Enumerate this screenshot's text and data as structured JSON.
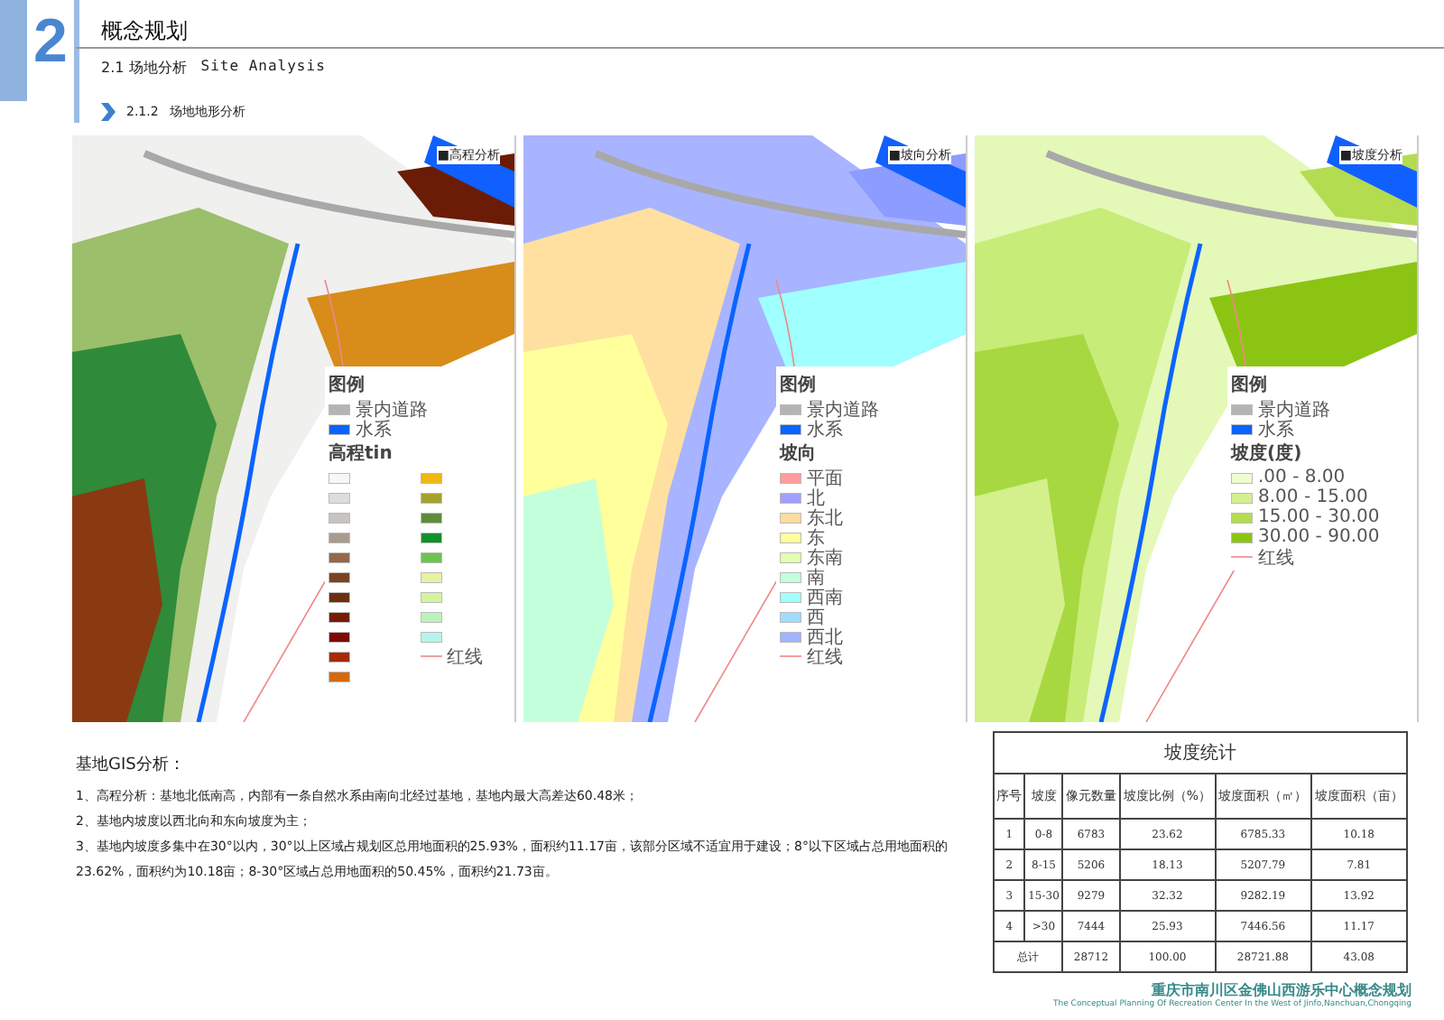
{
  "header": {
    "chapter_number": "2",
    "title": "概念规划",
    "section": "2.1 场地分析",
    "section_en": "Site Analysis",
    "subsection_number": "2.1.2",
    "subsection": "场地地形分析"
  },
  "maps": [
    {
      "kind": "elevation",
      "title": "■高程分析",
      "legend_title": "图例",
      "base_items": [
        {
          "label": "景内道路",
          "color": "#b4b4b4"
        },
        {
          "label": "水系",
          "color": "#0a64ff"
        }
      ],
      "class_title": "高程tin",
      "classes": [
        {
          "color": "#f7f7f7"
        },
        {
          "color": "#dddddd"
        },
        {
          "color": "#c6c3c0"
        },
        {
          "color": "#a99a8e"
        },
        {
          "color": "#94684c"
        },
        {
          "color": "#7a4424"
        },
        {
          "color": "#6e2e10"
        },
        {
          "color": "#761c04"
        },
        {
          "color": "#7c0a02"
        },
        {
          "color": "#a82a04"
        },
        {
          "color": "#d46a0c"
        },
        {
          "color": "#f0b812"
        },
        {
          "color": "#a4a22a"
        },
        {
          "color": "#5e8c3a"
        },
        {
          "color": "#12902e"
        },
        {
          "color": "#6cc44c"
        },
        {
          "color": "#e4f4a0"
        },
        {
          "color": "#d6f4a0"
        },
        {
          "color": "#b8f4bc"
        },
        {
          "color": "#b4f4ec"
        }
      ],
      "red_line": "红线"
    },
    {
      "kind": "aspect",
      "title": "■坡向分析",
      "legend_title": "图例",
      "base_items": [
        {
          "label": "景内道路",
          "color": "#b4b4b4"
        },
        {
          "label": "水系",
          "color": "#0a64ff"
        }
      ],
      "class_title": "坡向",
      "classes": [
        {
          "label": "平面",
          "color": "#ff9c9c"
        },
        {
          "label": "北",
          "color": "#a0a0ff"
        },
        {
          "label": "东北",
          "color": "#ffdca0"
        },
        {
          "label": "东",
          "color": "#ffff9c"
        },
        {
          "label": "东南",
          "color": "#e4ffb0"
        },
        {
          "label": "南",
          "color": "#c4ffdc"
        },
        {
          "label": "西南",
          "color": "#a0ffff"
        },
        {
          "label": "西",
          "color": "#a0dcff"
        },
        {
          "label": "西北",
          "color": "#a0b4ff"
        }
      ],
      "red_line": "红线"
    },
    {
      "kind": "slope",
      "title": "■坡度分析",
      "legend_title": "图例",
      "base_items": [
        {
          "label": "景内道路",
          "color": "#b4b4b4"
        },
        {
          "label": "水系",
          "color": "#0a64ff"
        }
      ],
      "class_title": "坡度(度)",
      "classes": [
        {
          "label": ".00 - 8.00",
          "color": "#eefcd0"
        },
        {
          "label": "8.00 - 15.00",
          "color": "#d4f08c"
        },
        {
          "label": "15.00 - 30.00",
          "color": "#b4dc50"
        },
        {
          "label": "30.00 - 90.00",
          "color": "#8cc414"
        }
      ],
      "red_line": "红线"
    }
  ],
  "analysis": {
    "title": "基地GIS分析：",
    "paragraphs": [
      "1、高程分析：基地北低南高，内部有一条自然水系由南向北经过基地，基地内最大高差达60.48米；",
      "2、基地内坡度以西北向和东向坡度为主；",
      "3、基地内坡度多集中在30°以内，30°以上区域占规划区总用地面积的25.93%，面积约11.17亩，该部分区域不适宜用于建设；8°以下区域占总用地面积的23.62%，面积约为10.18亩；8-30°区域占总用地面积的50.45%，面积约21.73亩。"
    ]
  },
  "table": {
    "title": "坡度统计",
    "columns": [
      "序号",
      "坡度",
      "像元数量",
      "坡度比例（%）",
      "坡度面积（㎡）",
      "坡度面积（亩）"
    ],
    "rows": [
      [
        "1",
        "0-8",
        "6783",
        "23.62",
        "6785.33",
        "10.18"
      ],
      [
        "2",
        "8-15",
        "5206",
        "18.13",
        "5207.79",
        "7.81"
      ],
      [
        "3",
        "15-30",
        "9279",
        "32.32",
        "9282.19",
        "13.92"
      ],
      [
        "4",
        ">30",
        "7444",
        "25.93",
        "7446.56",
        "11.17"
      ]
    ],
    "total": {
      "label": "总计",
      "values": [
        "28712",
        "100.00",
        "28721.88",
        "43.08"
      ]
    }
  },
  "footer": {
    "title": "重庆市南川区金佛山西游乐中心概念规划",
    "subtitle": "The Conceptual Planning Of Recreation Center In the West of Jinfo,Nanchuan,Chongqing"
  }
}
